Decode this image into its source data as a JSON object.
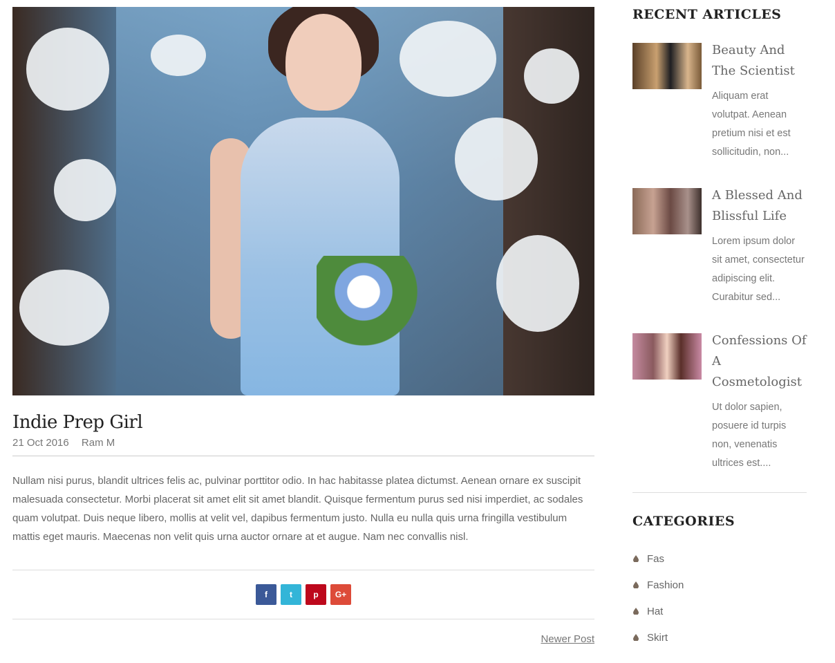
{
  "post": {
    "title": "Indie Prep Girl",
    "date": "21 Oct 2016",
    "author": "Ram M",
    "body": "Nullam nisi purus, blandit ultrices felis ac, pulvinar porttitor odio. In hac habitasse platea dictumst. Aenean ornare ex suscipit malesuada consectetur. Morbi placerat sit amet elit sit amet blandit. Quisque fermentum purus sed nisi imperdiet, ac sodales quam volutpat. Duis neque libero, mollis at velit vel, dapibus fermentum justo. Nulla eu nulla quis urna fringilla vestibulum mattis eget mauris. Maecenas non velit quis urna auctor ornare at et augue. Nam nec convallis nisl.",
    "share": [
      {
        "label": "f",
        "icon": "facebook-icon",
        "color": "#3b5998"
      },
      {
        "label": "t",
        "icon": "twitter-icon",
        "color": "#33b5d8"
      },
      {
        "label": "p",
        "icon": "pinterest-icon",
        "color": "#bd081c"
      },
      {
        "label": "G+",
        "icon": "google-plus-icon",
        "color": "#dd4b39"
      }
    ],
    "newer_label": "Newer Post"
  },
  "sidebar": {
    "recent_heading": "RECENT ARTICLES",
    "articles": [
      {
        "title": "Beauty And The Scientist",
        "excerpt": "Aliquam erat volutpat. Aenean pretium nisi et est sollicitudin, non..."
      },
      {
        "title": "A Blessed And Blissful Life",
        "excerpt": "Lorem ipsum dolor sit amet, consectetur adipiscing elit. Curabitur sed..."
      },
      {
        "title": "Confessions Of A Cosmetologist",
        "excerpt": "Ut dolor sapien, posuere id turpis non, venenatis ultrices est...."
      }
    ],
    "categories_heading": "CATEGORIES",
    "categories": [
      "Fas",
      "Fashion",
      "Hat",
      "Skirt"
    ]
  },
  "colors": {
    "accent": "#666666",
    "heading": "#222222",
    "drop_icon": "#7a6a5c"
  }
}
